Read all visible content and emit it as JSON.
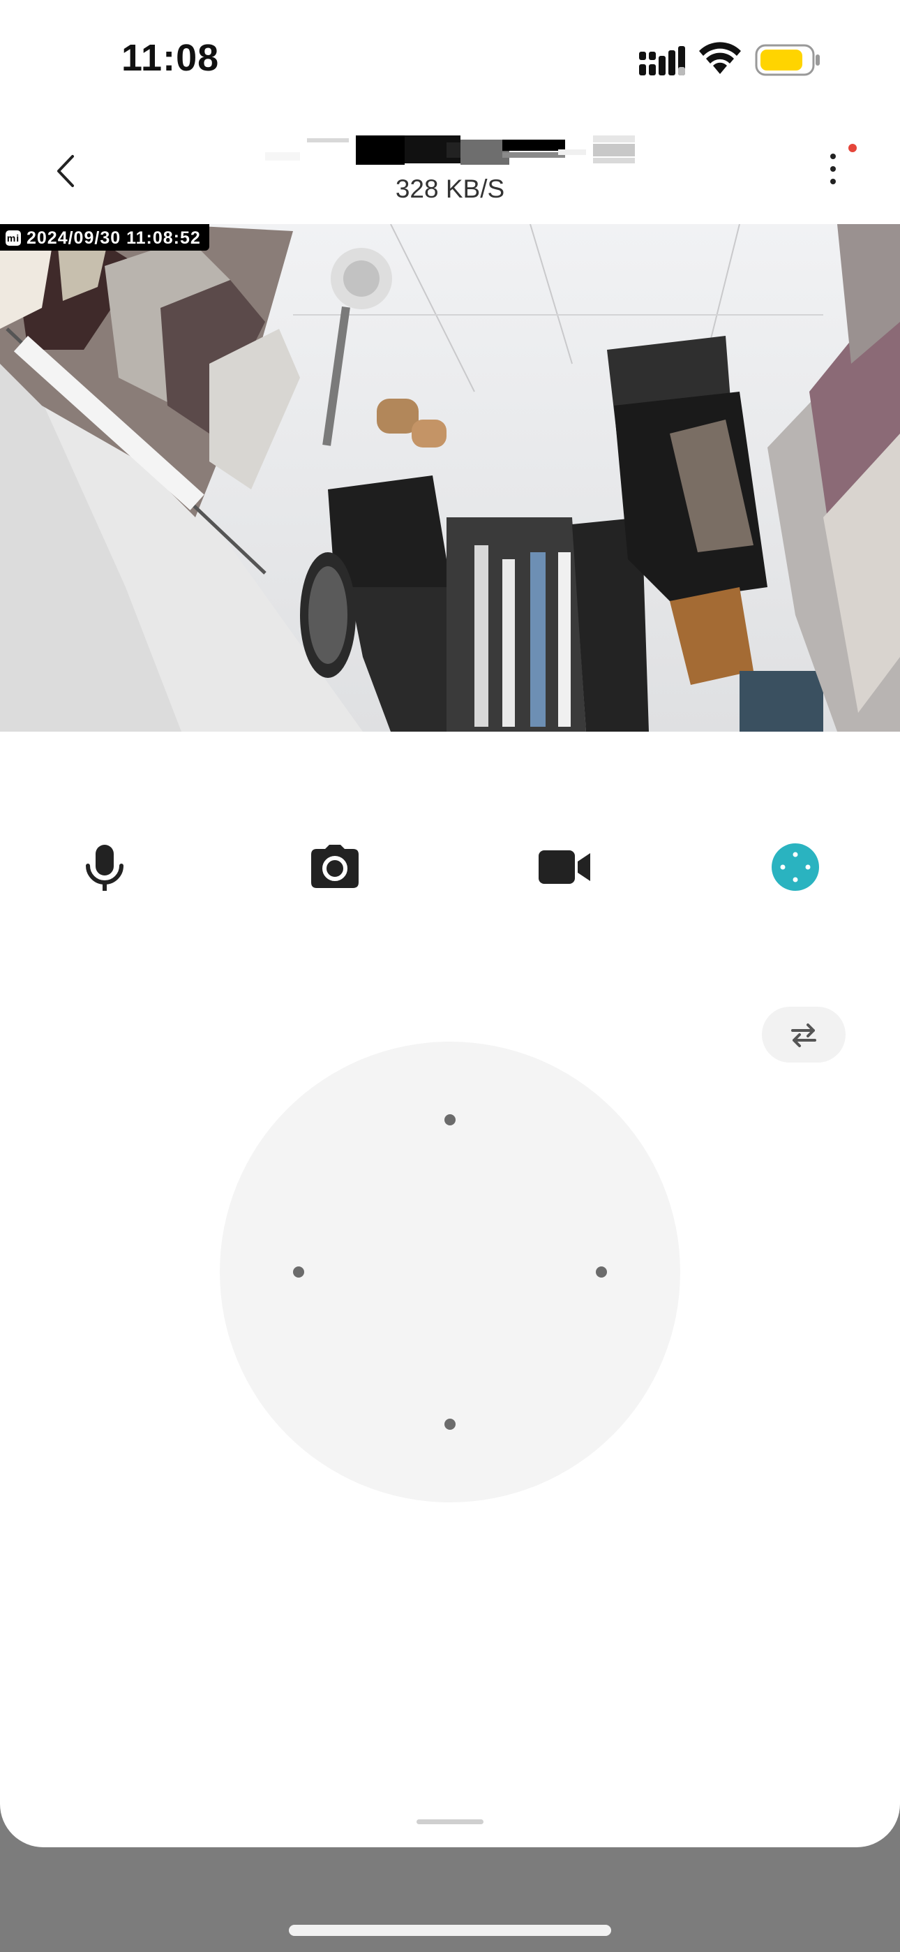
{
  "status_bar": {
    "time": "11:08",
    "icons": [
      "cellular-signal-icon",
      "wifi-icon",
      "battery-icon"
    ],
    "battery_color": "#ffd400"
  },
  "header": {
    "icons": [
      "chevron-left-icon",
      "more-vertical-icon"
    ],
    "title_redacted": true,
    "speed": "328 KB/S",
    "notification_dot_color": "#e5453a"
  },
  "feed": {
    "timestamp": "2024/09/30 11:08:52",
    "badge": "mi"
  },
  "controls": {
    "items": [
      {
        "name": "microphone",
        "icon": "microphone-icon"
      },
      {
        "name": "snapshot",
        "icon": "camera-icon"
      },
      {
        "name": "record",
        "icon": "video-camera-icon"
      },
      {
        "name": "ptz",
        "icon": "directional-pad-icon",
        "active": true
      }
    ],
    "accent": "#2ab3c0"
  },
  "ptz_panel": {
    "toggle_icon": "swap-arrows-icon",
    "directions": [
      "up",
      "left",
      "right",
      "down"
    ]
  }
}
